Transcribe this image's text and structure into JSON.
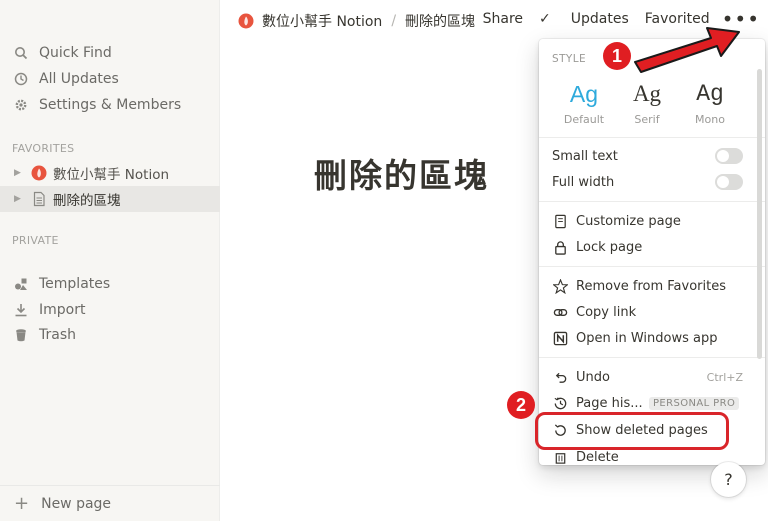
{
  "sidebar": {
    "quick_find": "Quick Find",
    "all_updates": "All Updates",
    "settings": "Settings & Members",
    "favorites_label": "FAVORITES",
    "favorites": [
      {
        "label": "數位小幫手 Notion"
      },
      {
        "label": "刪除的區塊"
      }
    ],
    "private_label": "PRIVATE",
    "templates": "Templates",
    "import": "Import",
    "trash": "Trash",
    "new_page": "New page"
  },
  "topbar": {
    "crumb_workspace": "數位小幫手 Notion",
    "crumb_sep": "/",
    "crumb_page": "刪除的區塊",
    "share": "Share",
    "updates": "Updates",
    "favorited": "Favorited",
    "more": "•••"
  },
  "page": {
    "title": "刪除的區塊"
  },
  "menu": {
    "style_label": "STYLE",
    "styles": [
      {
        "ag": "Ag",
        "caption": "Default"
      },
      {
        "ag": "Ag",
        "caption": "Serif"
      },
      {
        "ag": "Ag",
        "caption": "Mono"
      }
    ],
    "small_text": "Small text",
    "full_width": "Full width",
    "customize_page": "Customize page",
    "lock_page": "Lock page",
    "remove_favorites": "Remove from Favorites",
    "copy_link": "Copy link",
    "open_windows": "Open in Windows app",
    "undo": "Undo",
    "undo_shortcut": "Ctrl+Z",
    "page_history": "Page his...",
    "personal_pro": "PERSONAL PRO",
    "show_deleted": "Show deleted pages",
    "delete": "Delete"
  },
  "annotations": {
    "step1": "1",
    "step2": "2"
  },
  "help": "?",
  "colors": {
    "accent": "#2eaadc",
    "annotation_red": "#e01e22",
    "sidebar_bg": "#f7f6f3"
  }
}
